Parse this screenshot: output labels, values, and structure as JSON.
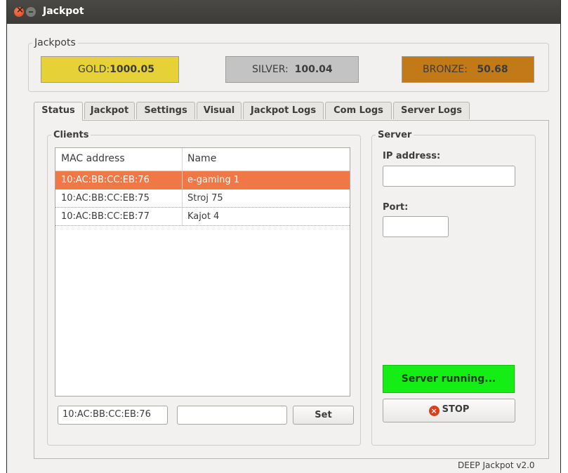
{
  "window": {
    "title": "Jackpot"
  },
  "jackpots": {
    "legend": "Jackpots",
    "gold": {
      "label": "GOLD:",
      "value": "1000.05"
    },
    "silver": {
      "label": "SILVER:",
      "value": "100.04"
    },
    "bronze": {
      "label": "BRONZE:",
      "value": "50.68"
    }
  },
  "tabs": [
    {
      "label": "Status"
    },
    {
      "label": "Jackpot"
    },
    {
      "label": "Settings"
    },
    {
      "label": "Visual"
    },
    {
      "label": "Jackpot Logs"
    },
    {
      "label": "Com Logs"
    },
    {
      "label": "Server Logs"
    }
  ],
  "clients": {
    "legend": "Clients",
    "columns": [
      "MAC address",
      "Name"
    ],
    "rows": [
      {
        "mac": "10:AC:BB:CC:EB:76",
        "name": "e-gaming 1"
      },
      {
        "mac": "10:AC:BB:CC:EB:75",
        "name": "Stroj 75"
      },
      {
        "mac": "10:AC:BB:CC:EB:77",
        "name": "Kajot 4"
      }
    ],
    "mac_input_value": "10:AC:BB:CC:EB:76",
    "name_input_value": "",
    "set_label": "Set"
  },
  "server": {
    "legend": "Server",
    "ip_label": "IP address:",
    "ip_value": "",
    "port_label": "Port:",
    "port_value": "",
    "status_text": "Server running...",
    "stop_label": "STOP",
    "status_color": "#14ee14"
  },
  "footer": {
    "version": "DEEP Jackpot v2.0"
  }
}
